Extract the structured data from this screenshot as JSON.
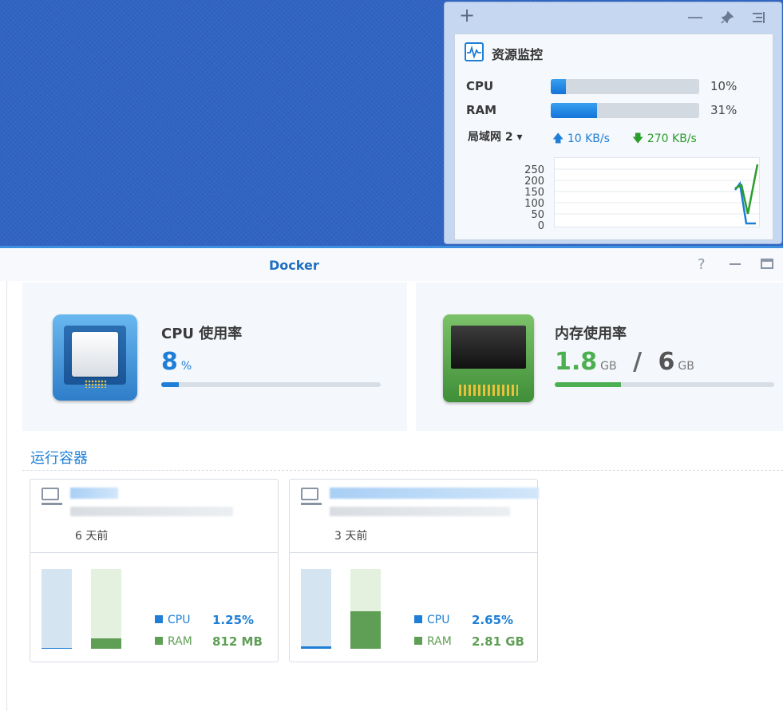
{
  "widget": {
    "title": "资源监控",
    "add_label": "+",
    "minimize_label": "—",
    "cpu": {
      "label": "CPU",
      "percent": 10,
      "value": "10%"
    },
    "ram": {
      "label": "RAM",
      "percent": 31,
      "value": "31%"
    },
    "network": {
      "selector": "局域网 2 ▾",
      "upload": "10 KB/s",
      "download": "270 KB/s"
    },
    "chart_axis": [
      "250",
      "200",
      "150",
      "100",
      "50",
      "0"
    ]
  },
  "docker": {
    "title": "Docker",
    "help_label": "?",
    "cpu_card": {
      "title": "CPU 使用率",
      "value": "8",
      "unit": "%",
      "percent": 8
    },
    "memory_card": {
      "title": "内存使用率",
      "used": "1.8",
      "used_unit": "GB",
      "separator": "/",
      "total": "6",
      "total_unit": "GB",
      "percent": 30
    },
    "running_title": "运行容器",
    "containers": [
      {
        "age": "6 天前",
        "cpu_label": "CPU",
        "cpu_value": "1.25%",
        "cpu_percent": 1.25,
        "ram_label": "RAM",
        "ram_value": "812 MB",
        "ram_percent": 13
      },
      {
        "age": "3 天前",
        "cpu_label": "CPU",
        "cpu_value": "2.65%",
        "cpu_percent": 2.65,
        "ram_label": "RAM",
        "ram_value": "2.81 GB",
        "ram_percent": 47
      }
    ]
  },
  "colors": {
    "accent": "#1f7fd6",
    "ram_green": "#5aaa4c",
    "memory_text_green": "#4caf50"
  }
}
